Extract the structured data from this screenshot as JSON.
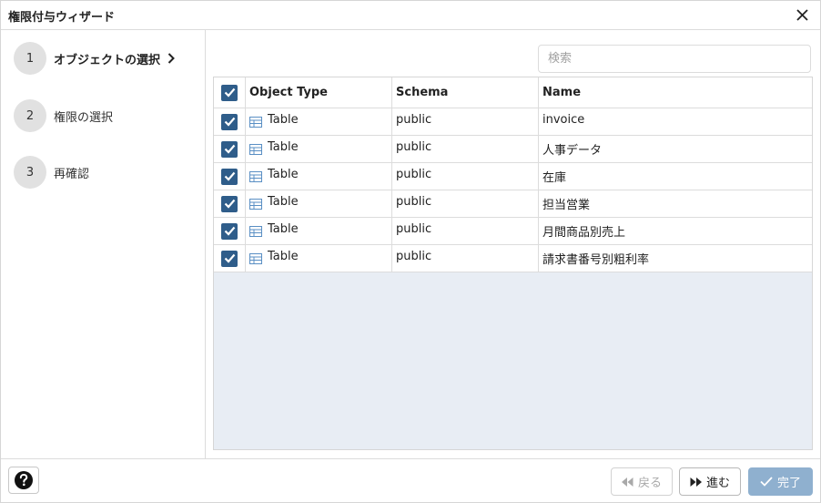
{
  "dialog": {
    "title": "権限付与ウィザード"
  },
  "steps": [
    {
      "number": "1",
      "label": "オブジェクトの選択",
      "active": true
    },
    {
      "number": "2",
      "label": "権限の選択",
      "active": false
    },
    {
      "number": "3",
      "label": "再確認",
      "active": false
    }
  ],
  "search": {
    "placeholder": "検索",
    "value": ""
  },
  "grid": {
    "columns": [
      "Object Type",
      "Schema",
      "Name"
    ],
    "rows": [
      {
        "checked": true,
        "object_type": "Table",
        "schema": "public",
        "name": "invoice"
      },
      {
        "checked": true,
        "object_type": "Table",
        "schema": "public",
        "name": "人事データ"
      },
      {
        "checked": true,
        "object_type": "Table",
        "schema": "public",
        "name": "在庫"
      },
      {
        "checked": true,
        "object_type": "Table",
        "schema": "public",
        "name": "担当営業"
      },
      {
        "checked": true,
        "object_type": "Table",
        "schema": "public",
        "name": "月間商品別売上"
      },
      {
        "checked": true,
        "object_type": "Table",
        "schema": "public",
        "name": "請求書番号別粗利率"
      }
    ]
  },
  "footer": {
    "help_icon": "question-circle-icon",
    "back_label": "戻る",
    "next_label": "進む",
    "finish_label": "完了"
  },
  "colors": {
    "checkbox": "#2f5d8a",
    "grid_empty": "#e8edf4",
    "finish_button": "#8fb0cf",
    "table_icon": "#5a8fc4"
  }
}
